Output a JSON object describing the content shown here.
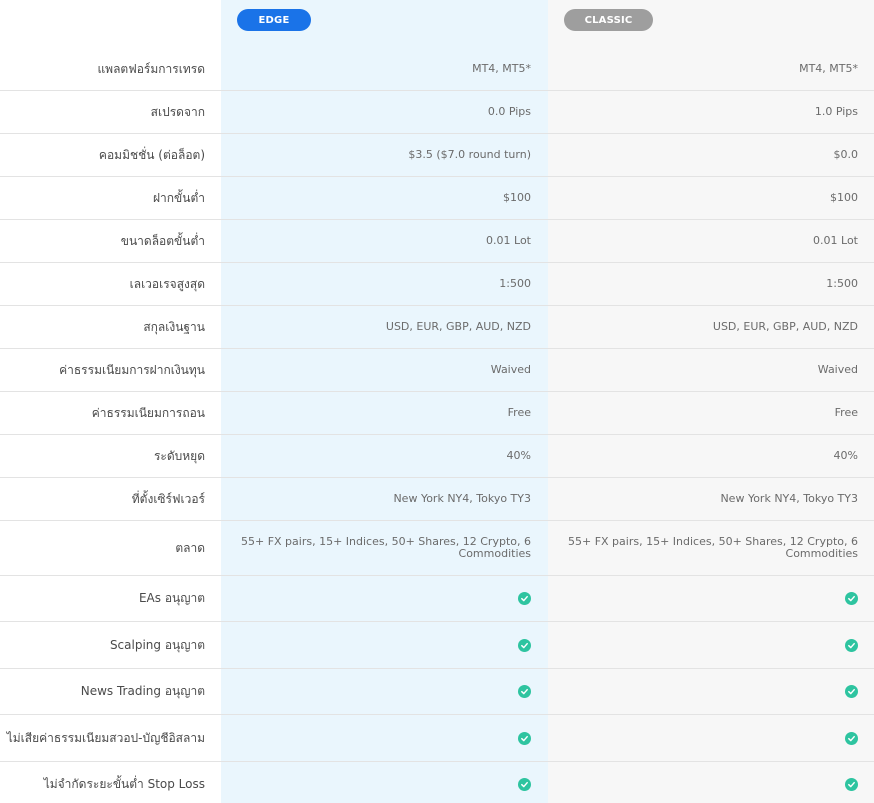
{
  "header": {
    "edge_label": "EDGE",
    "classic_label": "CLASSIC"
  },
  "rows": [
    {
      "label": "แพลตฟอร์มการเทรด",
      "edge": "MT4, MT5*",
      "classic": "MT4, MT5*"
    },
    {
      "label": "สเปรดจาก",
      "edge": "0.0 Pips",
      "classic": "1.0 Pips"
    },
    {
      "label": "คอมมิชชั่น (ต่อล็อต)",
      "edge": "$3.5 ($7.0 round turn)",
      "classic": "$0.0"
    },
    {
      "label": "ฝากขั้นต่ำ",
      "edge": "$100",
      "classic": "$100"
    },
    {
      "label": "ขนาดล็อตขั้นต่ำ",
      "edge": "0.01 Lot",
      "classic": "0.01 Lot"
    },
    {
      "label": "เลเวอเรจสูงสุด",
      "edge": "1:500",
      "classic": "1:500"
    },
    {
      "label": "สกุลเงินฐาน",
      "edge": "USD, EUR, GBP, AUD, NZD",
      "classic": "USD, EUR, GBP, AUD, NZD"
    },
    {
      "label": "ค่าธรรมเนียมการฝากเงินทุน",
      "edge": "Waived",
      "classic": "Waived"
    },
    {
      "label": "ค่าธรรมเนียมการถอน",
      "edge": "Free",
      "classic": "Free"
    },
    {
      "label": "ระดับหยุด",
      "edge": "40%",
      "classic": "40%"
    },
    {
      "label": "ที่ตั้งเซิร์ฟเวอร์",
      "edge": "New York NY4, Tokyo TY3",
      "classic": "New York NY4, Tokyo TY3"
    },
    {
      "label": "ตลาด",
      "edge": "55+ FX pairs, 15+ Indices, 50+ Shares, 12 Crypto, 6 Commodities",
      "classic": "55+ FX pairs, 15+ Indices, 50+ Shares, 12 Crypto, 6 Commodities"
    },
    {
      "label": "EAs อนุญาต",
      "edge_icon": "check-circle-icon",
      "classic_icon": "check-circle-icon"
    },
    {
      "label": "Scalping อนุญาต",
      "edge_icon": "check-circle-icon",
      "classic_icon": "check-circle-icon"
    },
    {
      "label": "News Trading อนุญาต",
      "edge_icon": "check-circle-icon",
      "classic_icon": "check-circle-icon"
    },
    {
      "label": "ไม่เสียค่าธรรมเนียมสวอป-บัญชีอิสลาม",
      "edge_icon": "check-circle-icon",
      "classic_icon": "check-circle-icon"
    },
    {
      "label": "ไม่จำกัดระยะขั้นต่ำ Stop Loss",
      "edge_icon": "check-circle-icon",
      "classic_icon": "check-circle-icon"
    }
  ],
  "colors": {
    "edge_accent": "#1a73e8",
    "classic_accent": "#9e9e9e",
    "check": "#2ec4a0",
    "edge_bg": "#eaf6fd",
    "classic_bg": "#f7f7f7"
  }
}
